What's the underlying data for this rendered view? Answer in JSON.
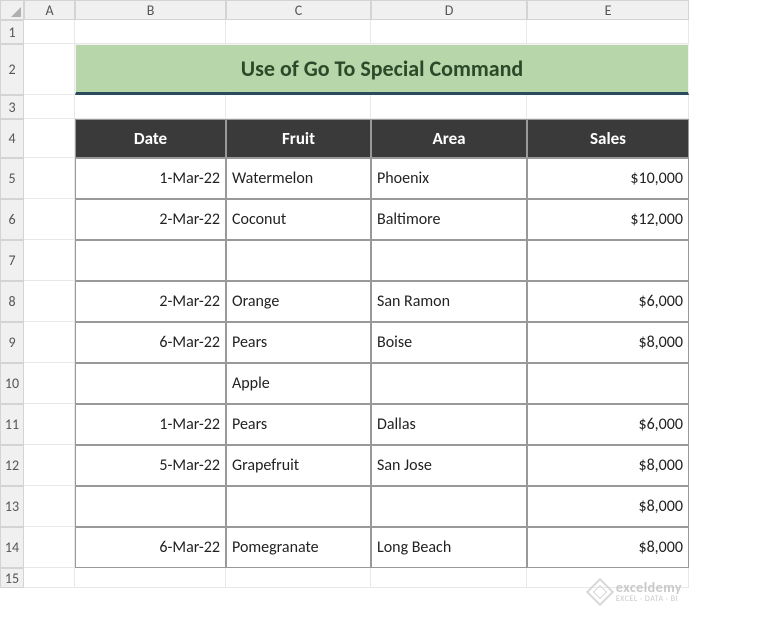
{
  "columns": [
    "A",
    "B",
    "C",
    "D",
    "E"
  ],
  "rows": [
    "1",
    "2",
    "3",
    "4",
    "5",
    "6",
    "7",
    "8",
    "9",
    "10",
    "11",
    "12",
    "13",
    "14",
    "15"
  ],
  "title": "Use of Go To Special Command",
  "headers": {
    "date": "Date",
    "fruit": "Fruit",
    "area": "Area",
    "sales": "Sales"
  },
  "chart_data": {
    "type": "table",
    "title": "Use of Go To Special Command",
    "columns": [
      "Date",
      "Fruit",
      "Area",
      "Sales"
    ],
    "rows": [
      {
        "date": "1-Mar-22",
        "fruit": "Watermelon",
        "area": "Phoenix",
        "sales": "$10,000"
      },
      {
        "date": "2-Mar-22",
        "fruit": "Coconut",
        "area": "Baltimore",
        "sales": "$12,000"
      },
      {
        "date": "",
        "fruit": "",
        "area": "",
        "sales": ""
      },
      {
        "date": "2-Mar-22",
        "fruit": "Orange",
        "area": "San Ramon",
        "sales": "$6,000"
      },
      {
        "date": "6-Mar-22",
        "fruit": "Pears",
        "area": "Boise",
        "sales": "$8,000"
      },
      {
        "date": "",
        "fruit": "Apple",
        "area": "",
        "sales": ""
      },
      {
        "date": "1-Mar-22",
        "fruit": "Pears",
        "area": "Dallas",
        "sales": "$6,000"
      },
      {
        "date": "5-Mar-22",
        "fruit": "Grapefruit",
        "area": "San Jose",
        "sales": "$8,000"
      },
      {
        "date": "",
        "fruit": "",
        "area": "",
        "sales": "$8,000"
      },
      {
        "date": "6-Mar-22",
        "fruit": "Pomegranate",
        "area": "Long Beach",
        "sales": "$8,000"
      }
    ]
  },
  "watermark": {
    "line1": "exceldemy",
    "line2": "EXCEL · DATA · BI"
  }
}
